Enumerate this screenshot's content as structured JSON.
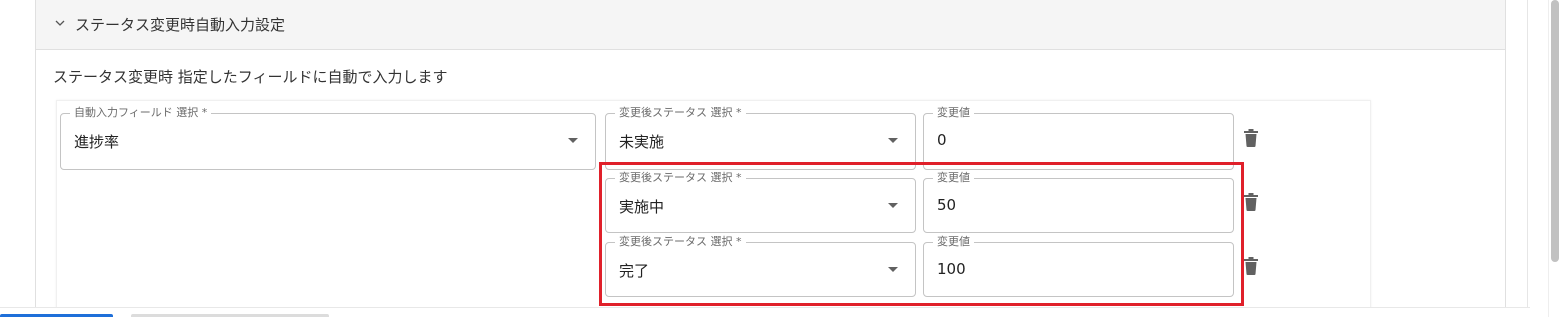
{
  "section": {
    "title": "ステータス変更時自動入力設定",
    "description": "ステータス変更時 指定したフィールドに自動で入力します"
  },
  "auto_field": {
    "label": "自動入力フィールド 選択 *",
    "value": "進捗率"
  },
  "rules": [
    {
      "status_label": "変更後ステータス 選択 *",
      "status_value": "未実施",
      "change_label": "変更値",
      "change_value": "0"
    },
    {
      "status_label": "変更後ステータス 選択 *",
      "status_value": "実施中",
      "change_label": "変更値",
      "change_value": "50"
    },
    {
      "status_label": "変更後ステータス 選択 *",
      "status_value": "完了",
      "change_label": "変更値",
      "change_value": "100"
    }
  ],
  "icons": {
    "expand": "chevron-down-icon",
    "dropdown": "caret-down-icon",
    "delete": "trash-icon"
  },
  "colors": {
    "highlight": "#e0202a",
    "header_bg": "#f5f5f5",
    "field_border": "#c4c4c4",
    "icon": "#616161"
  }
}
